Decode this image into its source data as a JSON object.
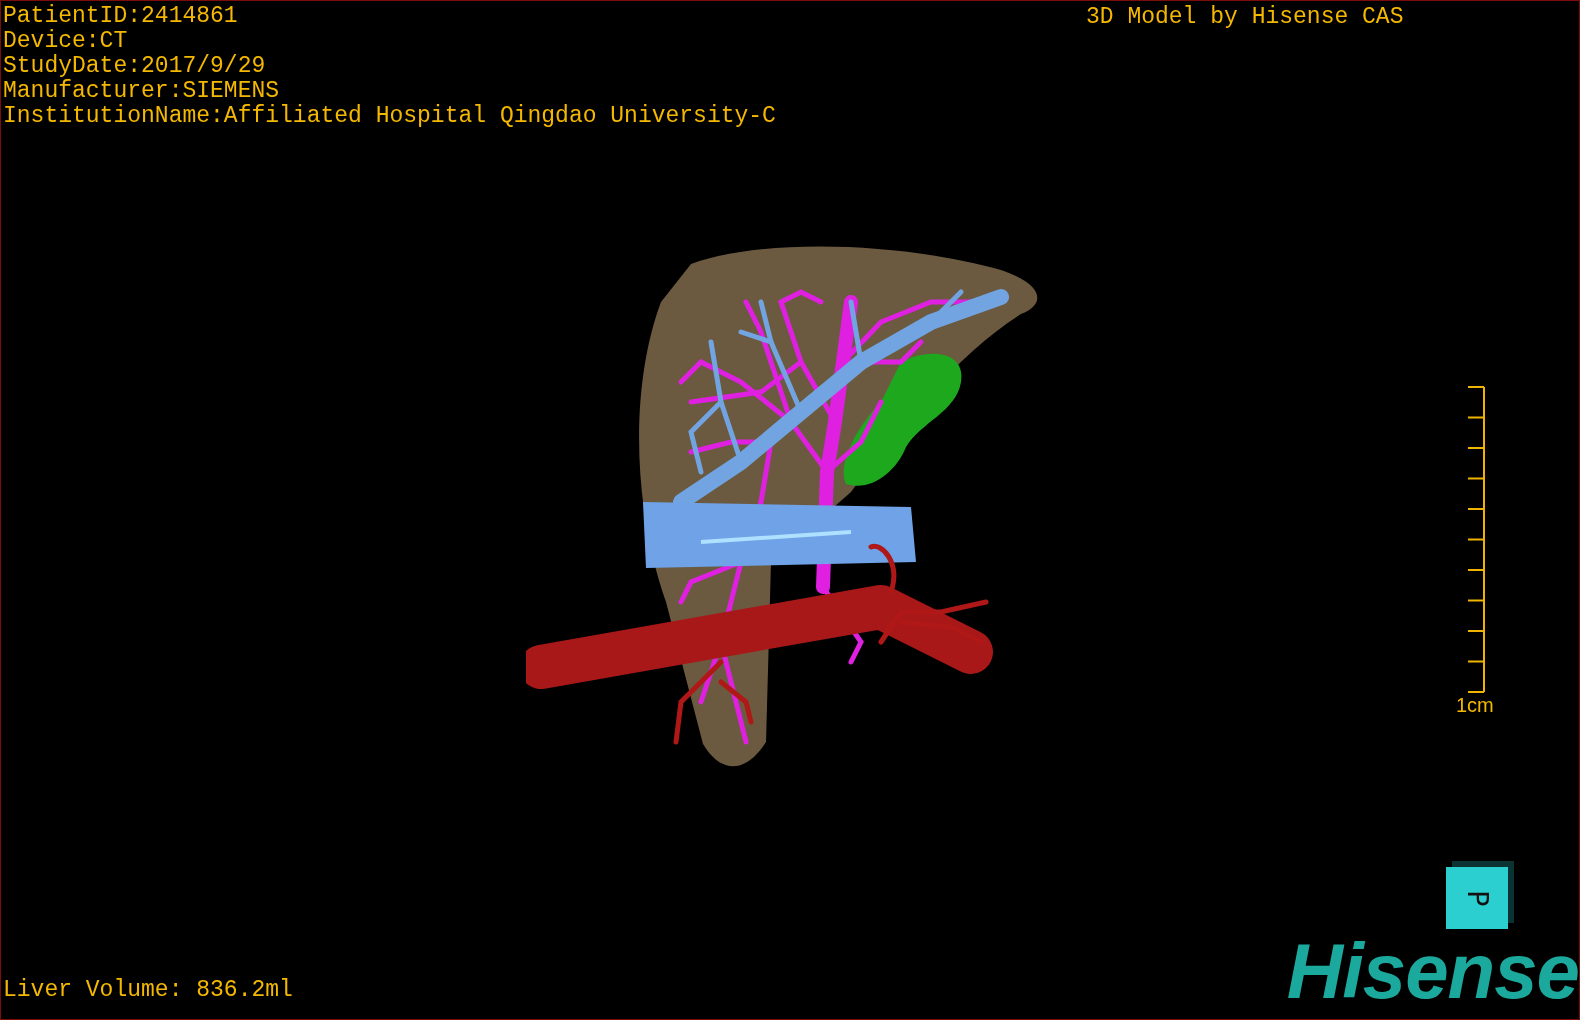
{
  "info_lines": [
    "PatientID:2414861",
    "Device:CT",
    "StudyDate:2017/9/29",
    "Manufacturer:SIEMENS",
    "InstitutionName:Affiliated Hospital Qingdao University-C"
  ],
  "model_credit": "3D Model by Hisense CAS",
  "scale_bar": {
    "label": "1cm"
  },
  "orientation_cube": {
    "face_label": "P"
  },
  "liver_volume": "Liver Volume: 836.2ml",
  "logo": "Hisense"
}
